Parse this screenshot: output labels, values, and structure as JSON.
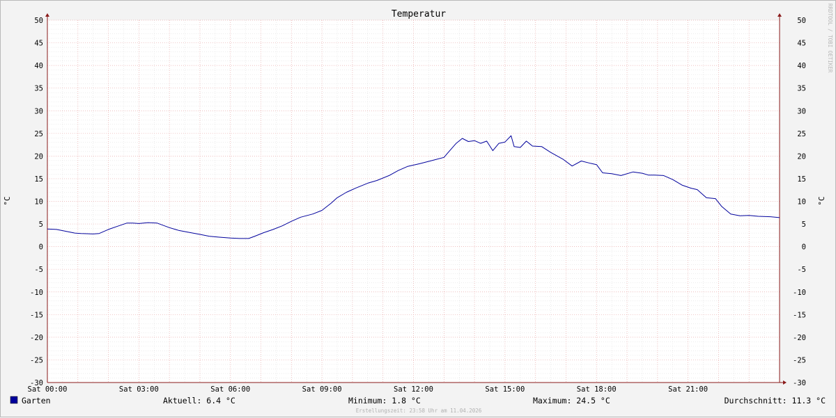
{
  "chart_data": {
    "type": "line",
    "title": "Temperatur",
    "ylabel": "°C",
    "ylim": [
      -30,
      50
    ],
    "yticks": [
      -30,
      -25,
      -20,
      -15,
      -10,
      -5,
      0,
      5,
      10,
      15,
      20,
      25,
      30,
      35,
      40,
      45,
      50
    ],
    "xlim": [
      0,
      24
    ],
    "xticks": [
      {
        "x": 0,
        "label": "Sat 00:00"
      },
      {
        "x": 3,
        "label": "Sat 03:00"
      },
      {
        "x": 6,
        "label": "Sat 06:00"
      },
      {
        "x": 9,
        "label": "Sat 09:00"
      },
      {
        "x": 12,
        "label": "Sat 12:00"
      },
      {
        "x": 15,
        "label": "Sat 15:00"
      },
      {
        "x": 18,
        "label": "Sat 18:00"
      },
      {
        "x": 21,
        "label": "Sat 21:00"
      }
    ],
    "grid": true,
    "series": [
      {
        "name": "Garten",
        "color": "#00009c",
        "x": [
          0.0,
          0.3,
          0.6,
          0.9,
          1.1,
          1.5,
          1.7,
          2.0,
          2.3,
          2.6,
          2.8,
          3.0,
          3.3,
          3.6,
          4.0,
          4.3,
          4.6,
          5.0,
          5.3,
          5.6,
          6.0,
          6.3,
          6.6,
          6.8,
          7.1,
          7.4,
          7.7,
          8.0,
          8.3,
          8.7,
          9.0,
          9.3,
          9.5,
          9.8,
          10.1,
          10.5,
          10.8,
          11.2,
          11.5,
          11.8,
          12.2,
          12.6,
          13.0,
          13.1,
          13.4,
          13.6,
          13.8,
          14.0,
          14.2,
          14.4,
          14.6,
          14.8,
          15.0,
          15.2,
          15.3,
          15.5,
          15.7,
          15.9,
          16.2,
          16.5,
          16.9,
          17.2,
          17.5,
          17.8,
          18.0,
          18.2,
          18.5,
          18.8,
          19.2,
          19.5,
          19.7,
          19.9,
          20.2,
          20.5,
          20.8,
          21.1,
          21.3,
          21.6,
          21.9,
          22.1,
          22.4,
          22.7,
          23.0,
          23.3,
          23.7,
          24.0
        ],
        "y": [
          3.9,
          3.8,
          3.4,
          3.0,
          2.9,
          2.8,
          2.9,
          3.8,
          4.5,
          5.2,
          5.2,
          5.1,
          5.3,
          5.2,
          4.2,
          3.6,
          3.2,
          2.7,
          2.3,
          2.1,
          1.9,
          1.8,
          1.8,
          2.3,
          3.1,
          3.8,
          4.6,
          5.6,
          6.5,
          7.2,
          8.0,
          9.6,
          10.8,
          12.0,
          12.9,
          14.0,
          14.6,
          15.7,
          16.8,
          17.7,
          18.3,
          19.0,
          19.7,
          20.5,
          22.8,
          23.9,
          23.2,
          23.4,
          22.8,
          23.3,
          21.2,
          22.8,
          23.1,
          24.5,
          22.1,
          21.9,
          23.3,
          22.2,
          22.1,
          20.8,
          19.3,
          17.8,
          18.9,
          18.4,
          18.1,
          16.3,
          16.1,
          15.7,
          16.5,
          16.2,
          15.8,
          15.8,
          15.7,
          14.8,
          13.6,
          12.9,
          12.6,
          10.8,
          10.6,
          8.9,
          7.2,
          6.8,
          6.9,
          6.7,
          6.6,
          6.4
        ]
      }
    ]
  },
  "legend": {
    "series_label": "Garten",
    "current": "Aktuell: 6.4 °C",
    "minimum": "Minimum: 1.8 °C",
    "maximum": "Maximum: 24.5 °C",
    "average": "Durchschnitt: 11.3 °C"
  },
  "footer": {
    "created": "Erstellungszeit: 23:58 Uhr am 11.04.2026"
  },
  "watermark": "RRDTOOL / TOBI OETIKER",
  "colors": {
    "series": "#00009c",
    "major_grid": "#e8a8a8",
    "minor_grid": "#d9d9d9",
    "axis": "#8a1a1a",
    "plot_background": "#ffffff"
  }
}
